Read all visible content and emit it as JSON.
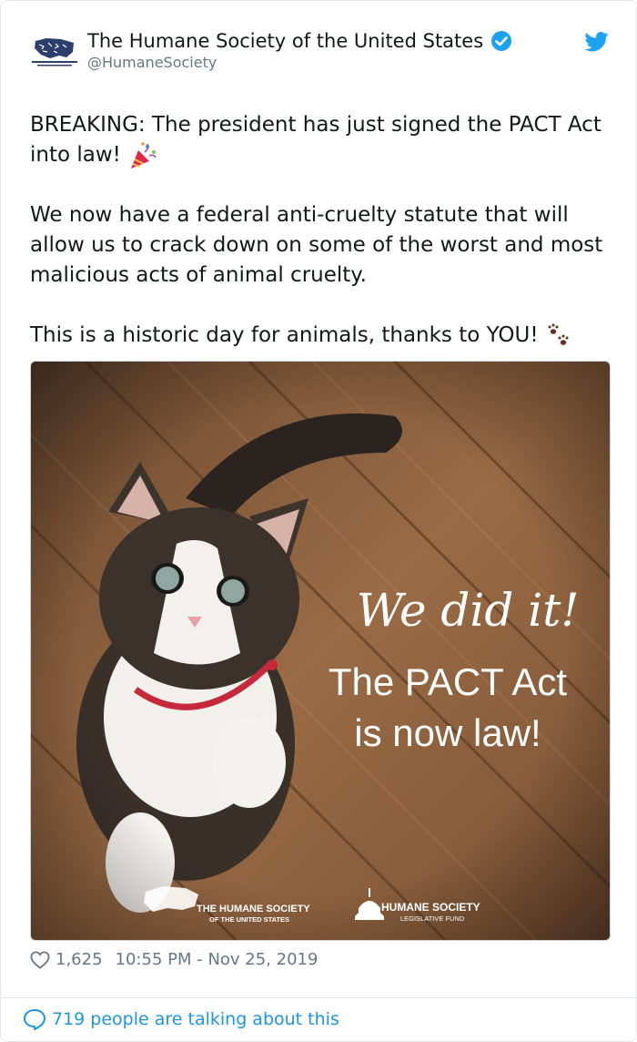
{
  "account": {
    "name": "The Humane Society of the United States",
    "handle": "@HumaneSociety",
    "avatar_icon": "hsus-logo"
  },
  "tweet": {
    "paragraphs": [
      "BREAKING: The president has just signed the PACT Act into law!",
      "We now have a federal anti-cruelty statute that will allow us to crack down on some of the worst and most malicious acts of animal cruelty.",
      "This is a historic day for animals, thanks to YOU!"
    ],
    "emoji": [
      "party-popper-icon",
      "paw-prints-icon"
    ]
  },
  "media": {
    "headline": "We did it!",
    "line1": "The PACT Act",
    "line2": "is now law!",
    "logo1_line1": "THE HUMANE SOCIETY",
    "logo1_line2": "OF THE UNITED STATES",
    "logo2_line1": "HUMANE SOCIETY",
    "logo2_line2": "LEGISLATIVE FUND"
  },
  "stats": {
    "likes": "1,625",
    "timestamp": "10:55 PM - Nov 25, 2019"
  },
  "footer": {
    "conversation": "719 people are talking about this"
  },
  "colors": {
    "twitter_blue": "#1da1f2",
    "link_blue": "#1b95e0",
    "muted": "#657786"
  }
}
